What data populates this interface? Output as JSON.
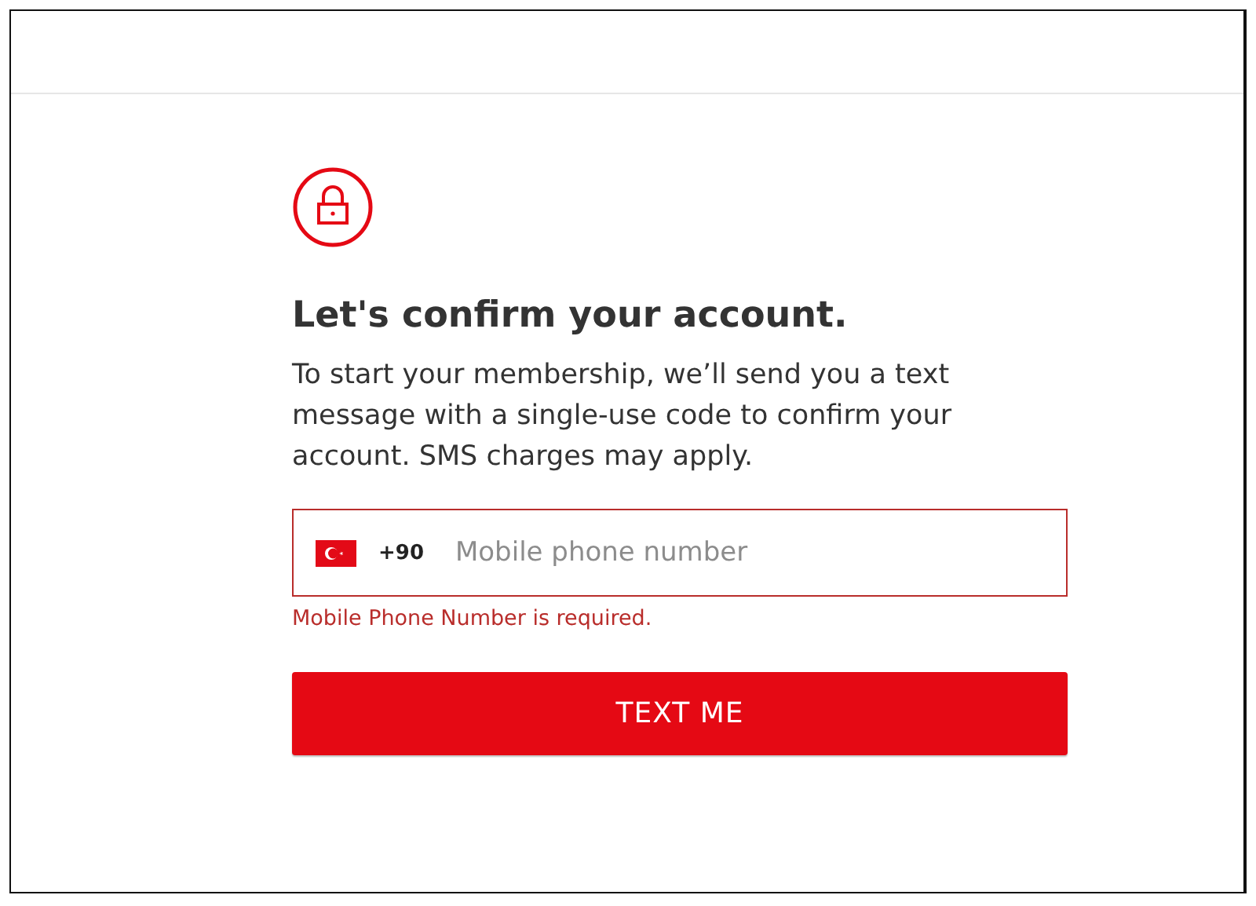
{
  "heading": "Let's confirm your account.",
  "message": "To start your membership, we’ll send you a text message with a single-use code to confirm your account. SMS charges may apply.",
  "phone_field": {
    "country_code": "+90",
    "placeholder": "Mobile phone number",
    "invalid": true,
    "error": "Mobile Phone Number is required."
  },
  "submit_button": {
    "label": "TEXT ME"
  }
}
